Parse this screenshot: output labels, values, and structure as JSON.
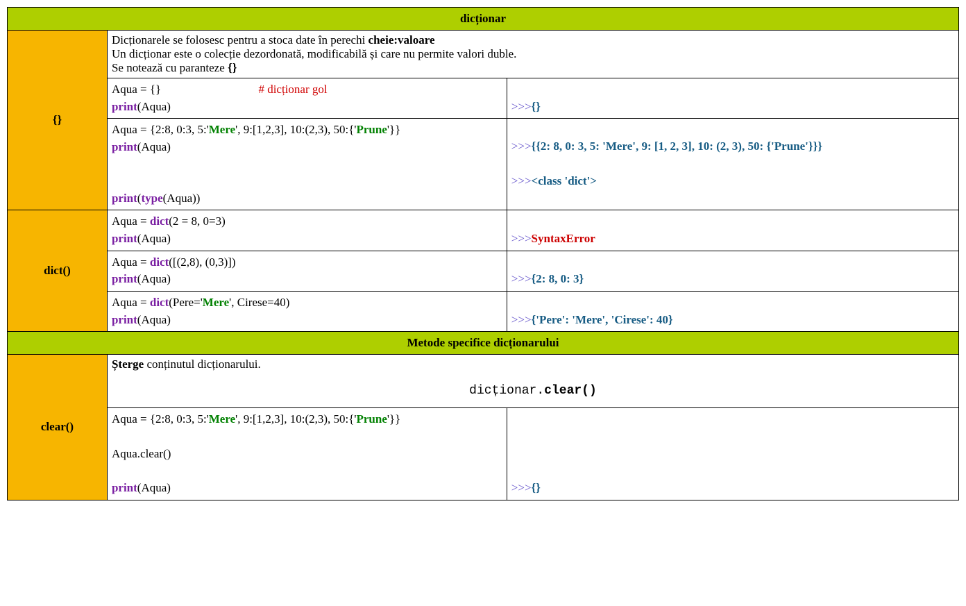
{
  "header1": "dicționar",
  "header2": "Metode specifice dicționarului",
  "labels": {
    "braces": "{}",
    "dict": "dict()",
    "clear": "clear()"
  },
  "desc": {
    "line1a": "Dicționarele se folosesc pentru a stoca date în perechi ",
    "line1b": "cheie:valoare",
    "line2": "Un dicționar este o colecție dezordonată, modificabilă și care nu permite valori duble.",
    "line3a": "Se notează cu paranteze ",
    "line3b": "{}"
  },
  "r1": {
    "c1": "Aqua = {}                                 ",
    "cmt": "# dicționar gol",
    "c2a": "print",
    "c2b": "(Aqua)",
    "out": "{}"
  },
  "r2": {
    "p1": "Aqua = {2:8, 0:3, 5:'",
    "s1": "Mere",
    "p2": "', 9:[1,2,3], 10:(2,3), 50:{'",
    "s2": "Prune",
    "p3": "'}}",
    "pr": "print",
    "prarg": "(Aqua)",
    "tp": "type",
    "tparen1": "(",
    "tparg": "(Aqua))",
    "out1": "{{2: 8, 0: 3, 5: 'Mere', 9: [1, 2, 3], 10: (2, 3), 50: {'Prune'}}}",
    "out2": "<class 'dict'>"
  },
  "r3": {
    "a1": "Aqua = ",
    "kd": "dict",
    "a2": "(2 = 8, 0=3)",
    "pr": "print",
    "prarg": "(Aqua)",
    "out": "SyntaxError"
  },
  "r4": {
    "a1": "Aqua = ",
    "kd": "dict",
    "a2": "([(2,8), (0,3)])",
    "pr": "print",
    "prarg": "(Aqua)",
    "out": "{2: 8, 0: 3}"
  },
  "r5": {
    "a1": "Aqua = ",
    "kd": "dict",
    "a2": "(Pere='",
    "s1": "Mere",
    "a3": "', Cirese=40)",
    "pr": "print",
    "prarg": "(Aqua)",
    "out": "{'Pere': 'Mere', 'Cirese': 40}"
  },
  "clear": {
    "d1": "Șterge",
    "d2": " conținutul dicționarului.",
    "syn1": "dicționar.",
    "syn2": "clear()",
    "p1": "Aqua = {2:8, 0:3, 5:'",
    "s1": "Mere",
    "p2": "', 9:[1,2,3], 10:(2,3), 50:{'",
    "s2": "Prune",
    "p3": "'}}",
    "call": "Aqua.clear()",
    "pr": "print",
    "prarg": "(Aqua)",
    "out": "{}"
  },
  "ppp": ">>>"
}
